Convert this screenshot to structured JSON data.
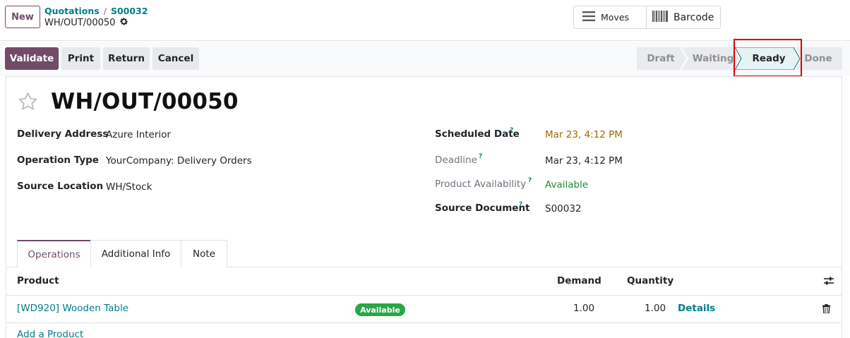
{
  "header": {
    "new_label": "New",
    "breadcrumb": {
      "parent": "Quotations",
      "separator": "/",
      "current_parent": "S00032",
      "record": "WH/OUT/00050"
    },
    "smart_buttons": {
      "moves": "Moves",
      "barcode": "Barcode"
    }
  },
  "actions": {
    "validate": "Validate",
    "print": "Print",
    "return": "Return",
    "cancel": "Cancel"
  },
  "statusbar": {
    "stages": [
      "Draft",
      "Waiting",
      "Ready",
      "Done"
    ],
    "active": "Ready"
  },
  "form": {
    "title": "WH/OUT/00050",
    "left": {
      "delivery_address_label": "Delivery Address",
      "delivery_address": "Azure Interior",
      "operation_type_label": "Operation Type",
      "operation_type": "YourCompany: Delivery Orders",
      "source_location_label": "Source Location",
      "source_location": "WH/Stock"
    },
    "right": {
      "scheduled_date_label": "Scheduled Date",
      "scheduled_date": "Mar 23, 4:12 PM",
      "deadline_label": "Deadline",
      "deadline": "Mar 23, 4:12 PM",
      "availability_label": "Product Availability",
      "availability": "Available",
      "source_document_label": "Source Document",
      "source_document": "S00032"
    },
    "tooltip_mark": "?"
  },
  "tabs": {
    "operations": "Operations",
    "additional_info": "Additional Info",
    "note": "Note"
  },
  "table": {
    "columns": {
      "product": "Product",
      "demand": "Demand",
      "quantity": "Quantity"
    },
    "rows": [
      {
        "product": "[WD920] Wooden Table",
        "status": "Available",
        "demand": "1.00",
        "quantity": "1.00",
        "details": "Details"
      }
    ],
    "add_product": "Add a Product"
  },
  "colors": {
    "primary": "#714b67",
    "link": "#017e84",
    "success": "#28a745",
    "warning": "#9f6a00",
    "highlight": "#e00000"
  },
  "icons": [
    "gear-icon",
    "hamburger-icon",
    "barcode-icon",
    "star-icon",
    "optional-columns-icon",
    "trash-icon"
  ]
}
